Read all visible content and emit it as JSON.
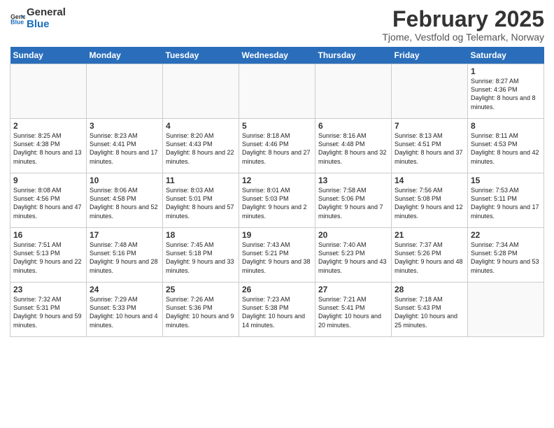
{
  "header": {
    "logo_general": "General",
    "logo_blue": "Blue",
    "month": "February 2025",
    "location": "Tjome, Vestfold og Telemark, Norway"
  },
  "days_of_week": [
    "Sunday",
    "Monday",
    "Tuesday",
    "Wednesday",
    "Thursday",
    "Friday",
    "Saturday"
  ],
  "weeks": [
    [
      {
        "day": "",
        "empty": true
      },
      {
        "day": "",
        "empty": true
      },
      {
        "day": "",
        "empty": true
      },
      {
        "day": "",
        "empty": true
      },
      {
        "day": "",
        "empty": true
      },
      {
        "day": "",
        "empty": true
      },
      {
        "day": "1",
        "sunrise": "8:27 AM",
        "sunset": "4:36 PM",
        "daylight": "8 hours and 8 minutes."
      }
    ],
    [
      {
        "day": "2",
        "sunrise": "8:25 AM",
        "sunset": "4:38 PM",
        "daylight": "8 hours and 13 minutes."
      },
      {
        "day": "3",
        "sunrise": "8:23 AM",
        "sunset": "4:41 PM",
        "daylight": "8 hours and 17 minutes."
      },
      {
        "day": "4",
        "sunrise": "8:20 AM",
        "sunset": "4:43 PM",
        "daylight": "8 hours and 22 minutes."
      },
      {
        "day": "5",
        "sunrise": "8:18 AM",
        "sunset": "4:46 PM",
        "daylight": "8 hours and 27 minutes."
      },
      {
        "day": "6",
        "sunrise": "8:16 AM",
        "sunset": "4:48 PM",
        "daylight": "8 hours and 32 minutes."
      },
      {
        "day": "7",
        "sunrise": "8:13 AM",
        "sunset": "4:51 PM",
        "daylight": "8 hours and 37 minutes."
      },
      {
        "day": "8",
        "sunrise": "8:11 AM",
        "sunset": "4:53 PM",
        "daylight": "8 hours and 42 minutes."
      }
    ],
    [
      {
        "day": "9",
        "sunrise": "8:08 AM",
        "sunset": "4:56 PM",
        "daylight": "8 hours and 47 minutes."
      },
      {
        "day": "10",
        "sunrise": "8:06 AM",
        "sunset": "4:58 PM",
        "daylight": "8 hours and 52 minutes."
      },
      {
        "day": "11",
        "sunrise": "8:03 AM",
        "sunset": "5:01 PM",
        "daylight": "8 hours and 57 minutes."
      },
      {
        "day": "12",
        "sunrise": "8:01 AM",
        "sunset": "5:03 PM",
        "daylight": "9 hours and 2 minutes."
      },
      {
        "day": "13",
        "sunrise": "7:58 AM",
        "sunset": "5:06 PM",
        "daylight": "9 hours and 7 minutes."
      },
      {
        "day": "14",
        "sunrise": "7:56 AM",
        "sunset": "5:08 PM",
        "daylight": "9 hours and 12 minutes."
      },
      {
        "day": "15",
        "sunrise": "7:53 AM",
        "sunset": "5:11 PM",
        "daylight": "9 hours and 17 minutes."
      }
    ],
    [
      {
        "day": "16",
        "sunrise": "7:51 AM",
        "sunset": "5:13 PM",
        "daylight": "9 hours and 22 minutes."
      },
      {
        "day": "17",
        "sunrise": "7:48 AM",
        "sunset": "5:16 PM",
        "daylight": "9 hours and 28 minutes."
      },
      {
        "day": "18",
        "sunrise": "7:45 AM",
        "sunset": "5:18 PM",
        "daylight": "9 hours and 33 minutes."
      },
      {
        "day": "19",
        "sunrise": "7:43 AM",
        "sunset": "5:21 PM",
        "daylight": "9 hours and 38 minutes."
      },
      {
        "day": "20",
        "sunrise": "7:40 AM",
        "sunset": "5:23 PM",
        "daylight": "9 hours and 43 minutes."
      },
      {
        "day": "21",
        "sunrise": "7:37 AM",
        "sunset": "5:26 PM",
        "daylight": "9 hours and 48 minutes."
      },
      {
        "day": "22",
        "sunrise": "7:34 AM",
        "sunset": "5:28 PM",
        "daylight": "9 hours and 53 minutes."
      }
    ],
    [
      {
        "day": "23",
        "sunrise": "7:32 AM",
        "sunset": "5:31 PM",
        "daylight": "9 hours and 59 minutes."
      },
      {
        "day": "24",
        "sunrise": "7:29 AM",
        "sunset": "5:33 PM",
        "daylight": "10 hours and 4 minutes."
      },
      {
        "day": "25",
        "sunrise": "7:26 AM",
        "sunset": "5:36 PM",
        "daylight": "10 hours and 9 minutes."
      },
      {
        "day": "26",
        "sunrise": "7:23 AM",
        "sunset": "5:38 PM",
        "daylight": "10 hours and 14 minutes."
      },
      {
        "day": "27",
        "sunrise": "7:21 AM",
        "sunset": "5:41 PM",
        "daylight": "10 hours and 20 minutes."
      },
      {
        "day": "28",
        "sunrise": "7:18 AM",
        "sunset": "5:43 PM",
        "daylight": "10 hours and 25 minutes."
      },
      {
        "day": "",
        "empty": true
      }
    ]
  ]
}
